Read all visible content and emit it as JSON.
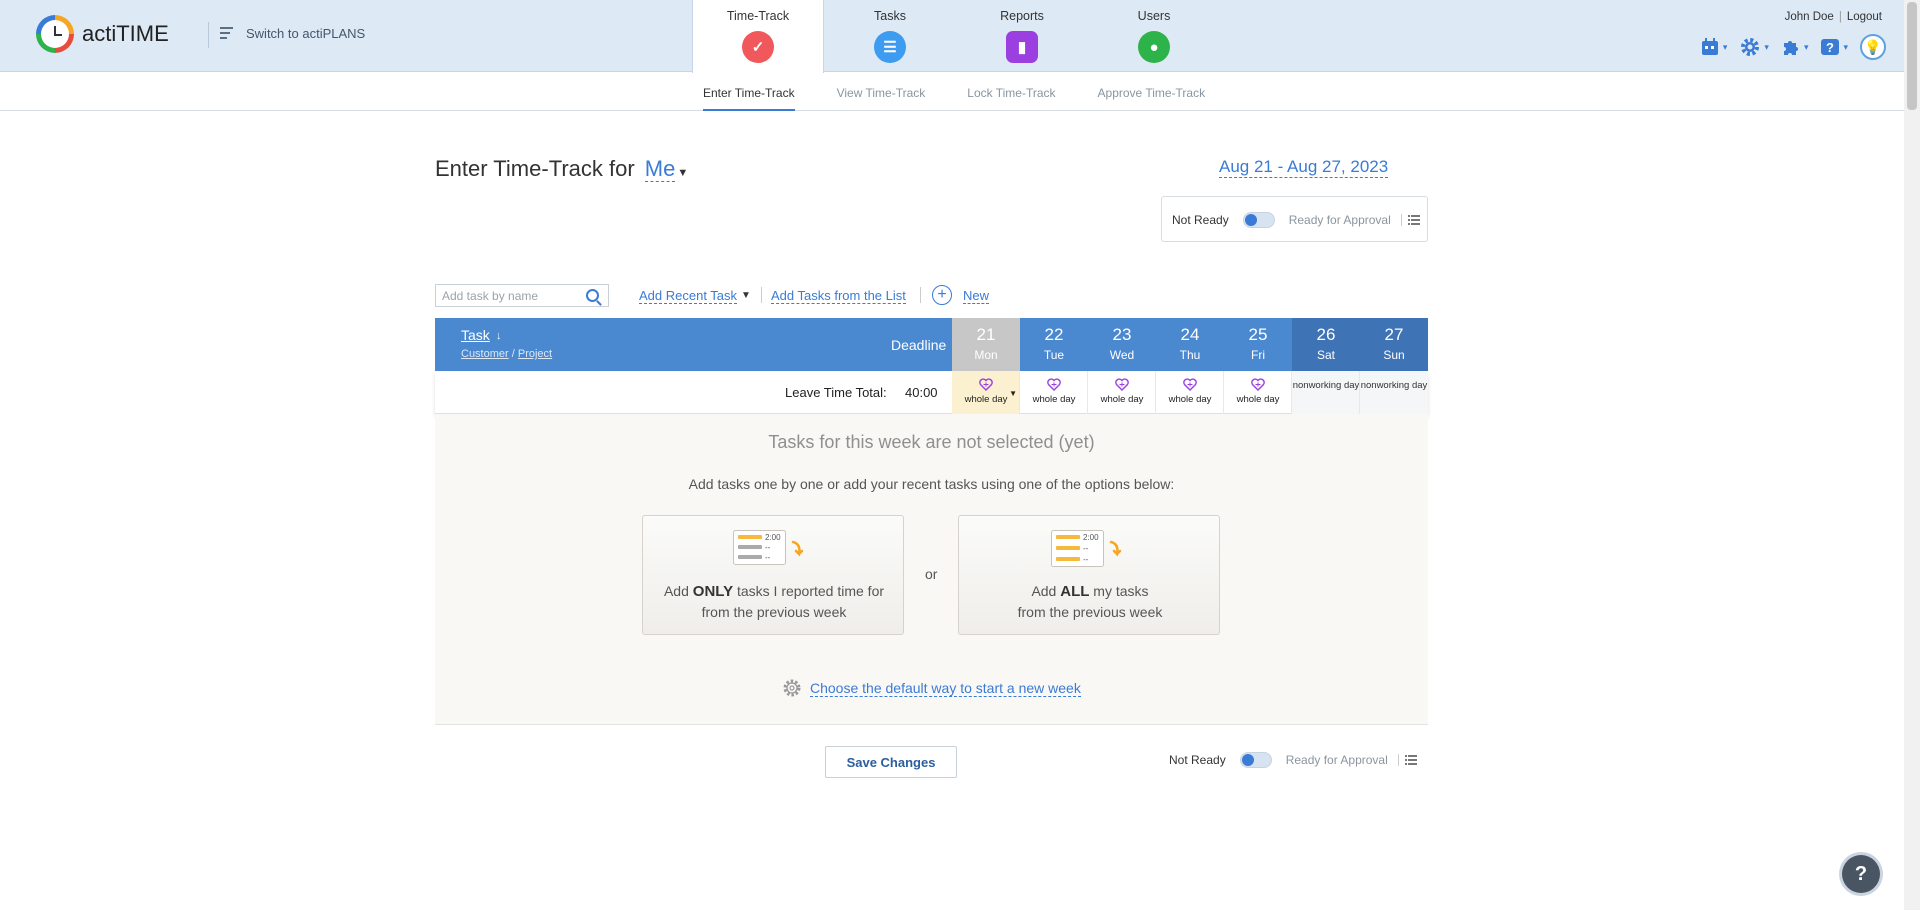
{
  "app": {
    "logo_text": "actiTIME",
    "switch_label": "Switch to actiPLANS"
  },
  "main_tabs": [
    {
      "label": "Time-Track",
      "icon": "check-icon",
      "color": "#f0585c"
    },
    {
      "label": "Tasks",
      "icon": "list-icon",
      "color": "#3d9bf0"
    },
    {
      "label": "Reports",
      "icon": "chart-icon",
      "color": "#9b3fe0"
    },
    {
      "label": "Users",
      "icon": "user-icon",
      "color": "#2db34a"
    }
  ],
  "user": {
    "name": "John Doe",
    "logout": "Logout"
  },
  "sub_tabs": [
    "Enter Time-Track",
    "View Time-Track",
    "Lock Time-Track",
    "Approve Time-Track"
  ],
  "heading": {
    "prefix": "Enter Time-Track for",
    "user_select": "Me",
    "date_range": "Aug 21 - Aug 27, 2023"
  },
  "status": {
    "not_ready": "Not Ready",
    "ready": "Ready for Approval"
  },
  "toolbar": {
    "search_placeholder": "Add task by name",
    "add_recent": "Add Recent Task",
    "add_from_list": "Add Tasks from the List",
    "new": "New"
  },
  "table": {
    "task_header": "Task",
    "customer": "Customer",
    "project": "Project",
    "slash": "/",
    "deadline": "Deadline",
    "days": [
      {
        "num": "21",
        "name": "Mon",
        "leave": "whole day",
        "type": "today"
      },
      {
        "num": "22",
        "name": "Tue",
        "leave": "whole day",
        "type": "work"
      },
      {
        "num": "23",
        "name": "Wed",
        "leave": "whole day",
        "type": "work"
      },
      {
        "num": "24",
        "name": "Thu",
        "leave": "whole day",
        "type": "work"
      },
      {
        "num": "25",
        "name": "Fri",
        "leave": "whole day",
        "type": "work"
      },
      {
        "num": "26",
        "name": "Sat",
        "leave": "nonworking day",
        "type": "weekend"
      },
      {
        "num": "27",
        "name": "Sun",
        "leave": "nonworking day",
        "type": "weekend"
      }
    ],
    "leave_label": "Leave Time Total:",
    "leave_total": "40:00"
  },
  "empty": {
    "title": "Tasks for this week are not selected (yet)",
    "subtitle": "Add tasks one by one or add your recent tasks using one of the options below:",
    "option1": {
      "pre": "Add ",
      "bold": "ONLY",
      "post": " tasks I reported time for",
      "line2": "from the previous week",
      "time": "2:00",
      "dash": "--"
    },
    "or": "or",
    "option2": {
      "pre": "Add ",
      "bold": "ALL",
      "post": " my tasks",
      "line2": "from the previous week",
      "time": "2:00",
      "dash": "--"
    },
    "default_link": "Choose the default way to start a new week"
  },
  "footer": {
    "save": "Save Changes"
  },
  "help": "?"
}
